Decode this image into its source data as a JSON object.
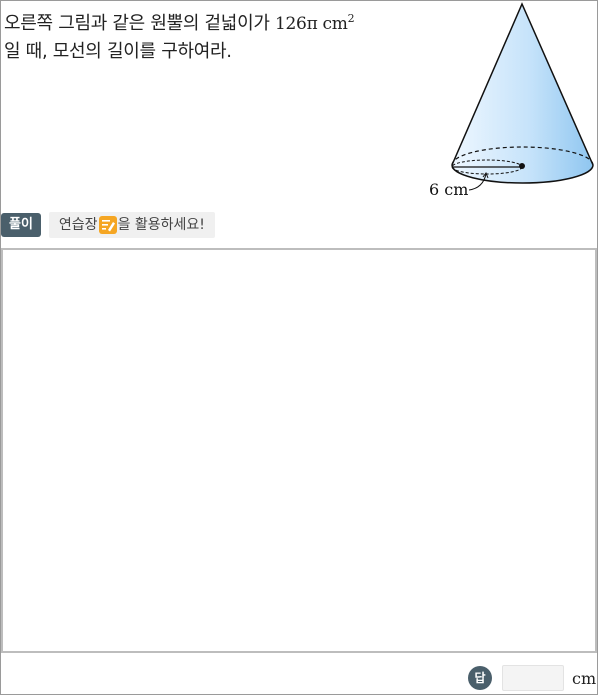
{
  "problem": {
    "line1_text": "오른쪽 그림과 같은 원뿔의 겉넓이가",
    "area_value": "126π cm",
    "area_exponent": "2",
    "line2_text": "일 때, 모선의 길이를 구하여라."
  },
  "figure": {
    "radius_label": "6 cm",
    "fill_color": "#a9d4f5"
  },
  "tags": {
    "solution_label": "풀이",
    "practice_prefix": "연습장",
    "practice_suffix": "을 활용하세요!"
  },
  "answer": {
    "badge_label": "답",
    "input_value": "",
    "unit_label": "cm"
  }
}
